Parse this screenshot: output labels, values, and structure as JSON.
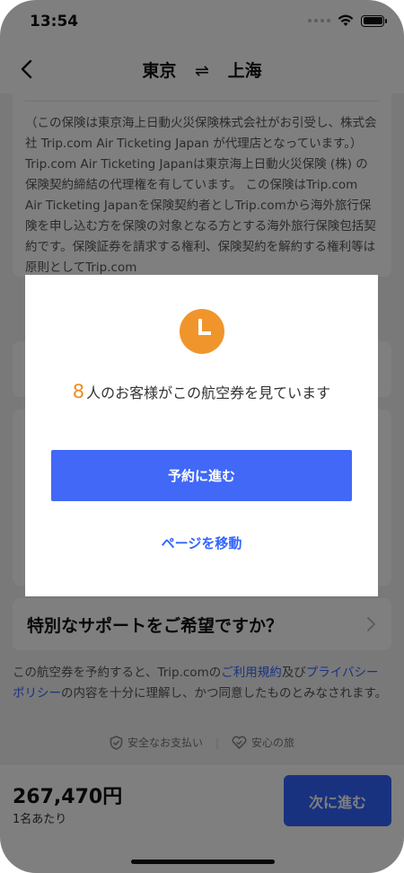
{
  "status_bar": {
    "time": "13:54"
  },
  "header": {
    "origin": "東京",
    "swap_symbol": "⇌",
    "destination": "上海"
  },
  "legal_text": "（この保険は東京海上日動火災保険株式会社がお引受し、株式会社 Trip.com Air Ticketing Japan が代理店となっています。）Trip.com Air Ticketing Japanは東京海上日動火災保険 (株) の保険契約締結の代理権を有しています。 この保険はTrip.com Air Ticketing Japanを保険契約者としTrip.comから海外旅行保険を申し込む方を保険の対象となる方とする海外旅行保険包括契約です。保険証券を請求する権利、保険契約を解約する権利等は原則としてTrip.com",
  "support": {
    "title": "特別なサポートをご希望ですか？"
  },
  "terms": {
    "prefix": "この航空券を予約すると、Trip.comの",
    "terms_link": "ご利用規約",
    "middle": "及び",
    "privacy_link": "プライバシーポリシー",
    "suffix": "の内容を十分に理解し、かつ同意したものとみなされます。"
  },
  "trust": {
    "safe_payment": "安全なお支払い",
    "safe_travel": "安心の旅"
  },
  "bottom_bar": {
    "price": "267,470円",
    "price_note": "1名あたり",
    "next_label": "次に進む"
  },
  "modal": {
    "viewer_count": "8",
    "viewer_text": "人のお客様がこの航空券を見ています",
    "proceed_label": "予約に進む",
    "move_label": "ページを移動"
  },
  "colors": {
    "accent": "#3264ff",
    "modal_button": "#4168f7",
    "clock": "#f0952b",
    "count": "#f08a1f"
  }
}
